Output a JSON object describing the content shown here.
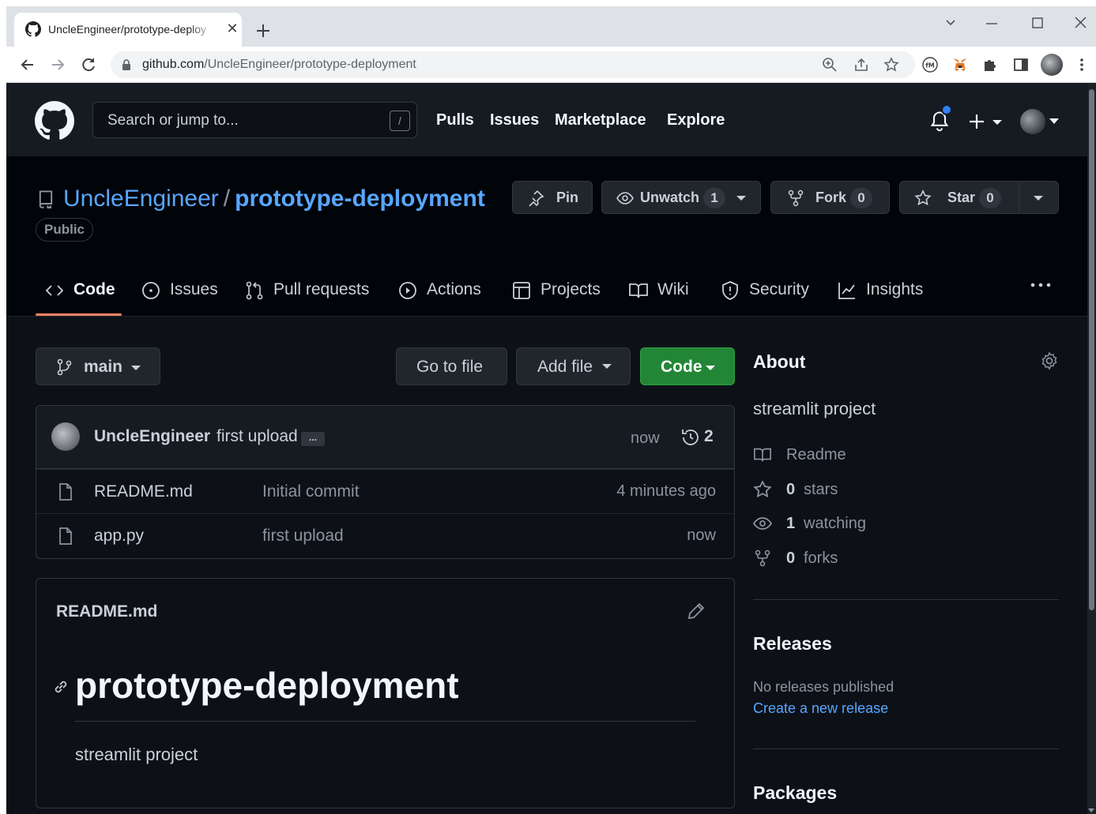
{
  "browser": {
    "tab_title": "UncleEngineer/prototype-deploy",
    "tab_close": "✕",
    "url_host": "github.com",
    "url_path": "/UncleEngineer/prototype-deployment",
    "extensions": [
      "zoom-icon",
      "share-icon",
      "star-icon",
      "m-extension-icon",
      "metamask-icon",
      "puzzle-icon",
      "sidepanel-icon",
      "profile-avatar",
      "menu-icon"
    ]
  },
  "header": {
    "search_placeholder": "Search or jump to...",
    "search_shortcut": "/",
    "nav": [
      "Pulls",
      "Issues",
      "Marketplace",
      "Explore"
    ]
  },
  "repo": {
    "owner": "UncleEngineer",
    "separator": "/",
    "name": "prototype-deployment",
    "visibility": "Public",
    "pin_label": "Pin",
    "watch_label": "Unwatch",
    "watch_count": "1",
    "fork_label": "Fork",
    "fork_count": "0",
    "star_label": "Star",
    "star_count": "0"
  },
  "tabs": [
    "Code",
    "Issues",
    "Pull requests",
    "Actions",
    "Projects",
    "Wiki",
    "Security",
    "Insights"
  ],
  "toolbar": {
    "branch": "main",
    "goto_file": "Go to file",
    "add_file": "Add file",
    "code": "Code"
  },
  "commit": {
    "author": "UncleEngineer",
    "message": "first upload",
    "ellipsis": "...",
    "time": "now",
    "count": "2"
  },
  "files": [
    {
      "name": "README.md",
      "message": "Initial commit",
      "time": "4 minutes ago"
    },
    {
      "name": "app.py",
      "message": "first upload",
      "time": "now"
    }
  ],
  "readme": {
    "filename": "README.md",
    "heading": "prototype-deployment",
    "paragraph": "streamlit project"
  },
  "about": {
    "title": "About",
    "description": "streamlit project",
    "readme": "Readme",
    "stars_num": "0",
    "stars_txt": "stars",
    "watching_num": "1",
    "watching_txt": "watching",
    "forks_num": "0",
    "forks_txt": "forks"
  },
  "releases": {
    "title": "Releases",
    "none": "No releases published",
    "create": "Create a new release"
  },
  "packages": {
    "title": "Packages"
  },
  "colors": {
    "accent_link": "#58a6ff",
    "code_button": "#238636",
    "tab_underline": "#f78166",
    "page_bg": "#0d1117"
  }
}
